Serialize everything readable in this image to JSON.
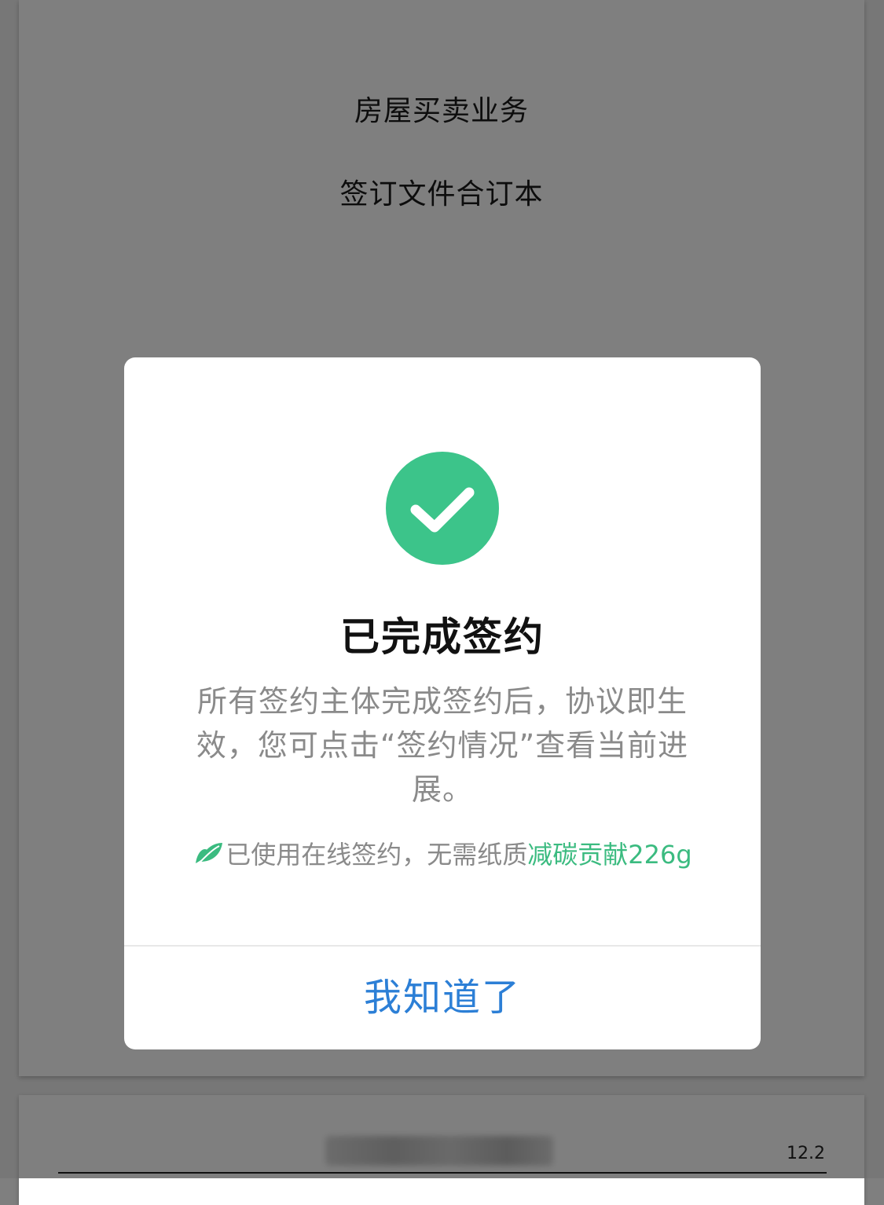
{
  "document": {
    "title_line1": "房屋买卖业务",
    "title_line2": "签订文件合订本",
    "page_number": "12.2"
  },
  "modal": {
    "icon": "check-circle-icon",
    "title": "已完成签约",
    "description": "所有签约主体完成签约后，协议即生效，您可点击“签约情况”查看当前进展。",
    "eco_icon": "leaf-icon",
    "eco_text": "已使用在线签约，无需纸质",
    "eco_highlight": "减碳贡献226g",
    "confirm_label": "我知道了"
  },
  "colors": {
    "success_green": "#3cc48a",
    "eco_green": "#3bbb80",
    "link_blue": "#2c7fd6",
    "overlay": "rgba(0,0,0,0.5)"
  }
}
